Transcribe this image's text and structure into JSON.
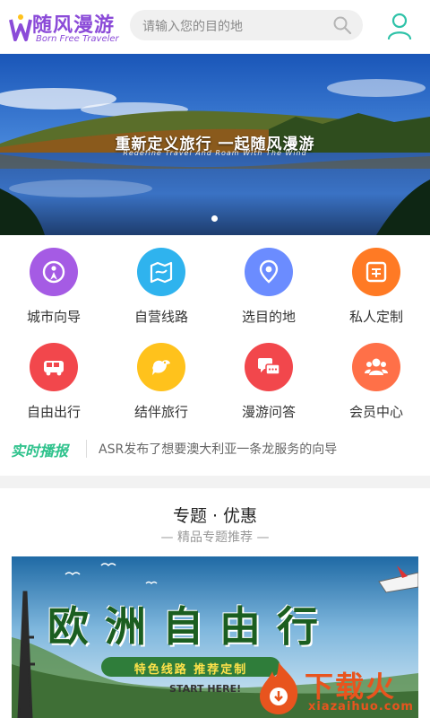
{
  "header": {
    "logo_cn": "随风漫游",
    "logo_en": "Born Free Traveler",
    "search_placeholder": "请输入您的目的地"
  },
  "banner": {
    "title": "重新定义旅行 一起随风漫游",
    "subtitle": "Redefine Travel And Roam With The Wind",
    "active_slide": 1,
    "slide_count": 1
  },
  "grid": [
    {
      "label": "城市向导",
      "icon": "city-guide-icon",
      "color": "#a55be4"
    },
    {
      "label": "自营线路",
      "icon": "map-route-icon",
      "color": "#2fb3ee"
    },
    {
      "label": "选目的地",
      "icon": "location-pin-icon",
      "color": "#6b8cff"
    },
    {
      "label": "私人定制",
      "icon": "custom-stamp-icon",
      "color": "#ff7a24"
    },
    {
      "label": "自由出行",
      "icon": "bus-icon",
      "color": "#f2474c"
    },
    {
      "label": "结伴旅行",
      "icon": "bird-icon",
      "color": "#ffc21c"
    },
    {
      "label": "漫游问答",
      "icon": "chat-bubbles-icon",
      "color": "#f2474c"
    },
    {
      "label": "会员中心",
      "icon": "members-icon",
      "color": "#ff7048"
    }
  ],
  "ticker": {
    "tag": "实时播报",
    "text": "ASR发布了想要澳大利亚一条龙服务的向导"
  },
  "section": {
    "title": "专题 · 优惠",
    "subtitle": "— 精品专题推荐 —"
  },
  "promo": {
    "title": "欧洲自由行",
    "tagline": "特色线路 推荐定制",
    "cta": "START HERE!"
  },
  "watermark": {
    "brand": "下载火",
    "url": "xiazaihuo.com"
  },
  "colors": {
    "accent_purple": "#8b4bd8",
    "teal": "#2ec2a8",
    "ticker_green": "#2ec28c",
    "watermark_orange": "#e8541e"
  }
}
